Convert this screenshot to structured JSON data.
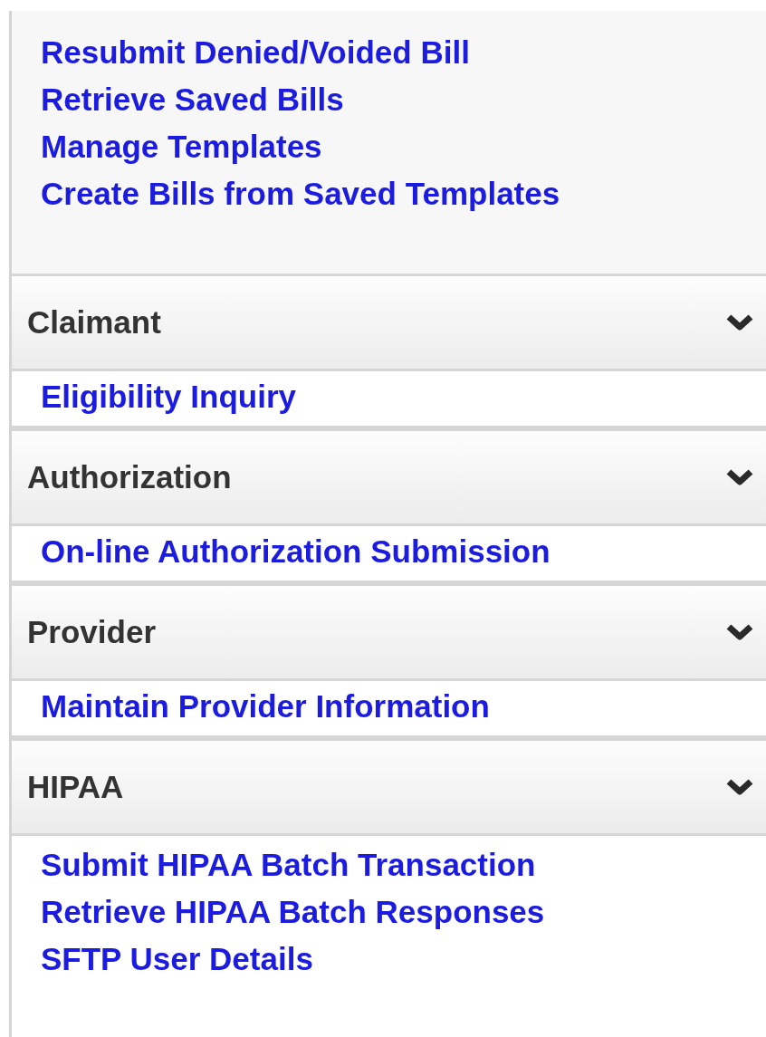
{
  "top_links": [
    "Resubmit Denied/Voided Bill",
    "Retrieve Saved Bills",
    "Manage Templates",
    "Create Bills from Saved Templates"
  ],
  "sections": [
    {
      "title": "Claimant",
      "expanded": true,
      "links": [
        "Eligibility Inquiry"
      ]
    },
    {
      "title": "Authorization",
      "expanded": true,
      "links": [
        "On-line Authorization Submission"
      ]
    },
    {
      "title": "Provider",
      "expanded": true,
      "links": [
        "Maintain Provider Information"
      ]
    },
    {
      "title": "HIPAA",
      "expanded": true,
      "links": [
        "Submit HIPAA Batch Transaction",
        "Retrieve HIPAA Batch Responses",
        "SFTP User Details"
      ]
    }
  ]
}
